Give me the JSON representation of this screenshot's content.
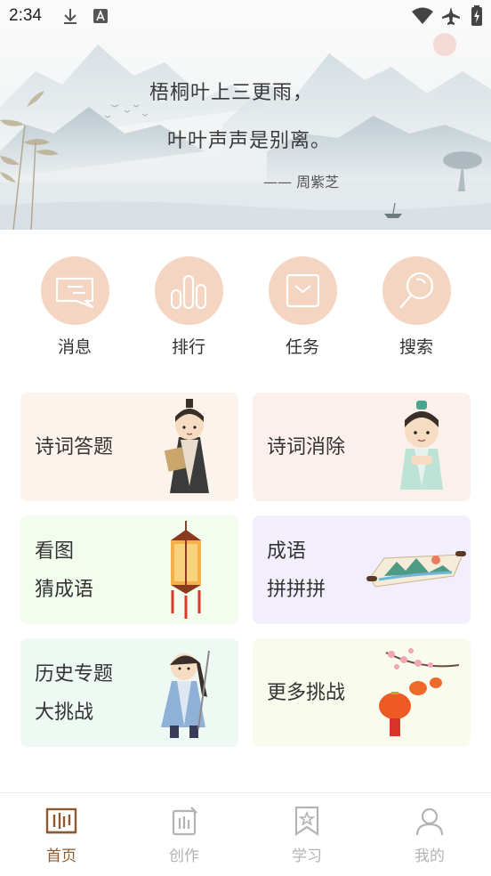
{
  "status_bar": {
    "time": "2:34"
  },
  "hero": {
    "line1": "梧桐叶上三更雨，",
    "line2": "叶叶声声是别离。",
    "author": "—— 周紫芝"
  },
  "quick_actions": [
    {
      "label": "消息",
      "icon": "message-icon"
    },
    {
      "label": "排行",
      "icon": "ranking-icon"
    },
    {
      "label": "任务",
      "icon": "task-icon"
    },
    {
      "label": "搜索",
      "icon": "search-icon"
    }
  ],
  "cards": {
    "poem_quiz": {
      "lines": [
        "诗词答题"
      ]
    },
    "poem_eliminate": {
      "lines": [
        "诗词消除"
      ]
    },
    "guess_idiom": {
      "lines": [
        "看图",
        "猜成语"
      ]
    },
    "idiom_puzzle": {
      "lines": [
        "成语",
        "拼拼拼"
      ]
    },
    "history_challenge": {
      "lines": [
        "历史专题",
        "大挑战"
      ]
    },
    "more_challenges": {
      "lines": [
        "更多挑战"
      ]
    }
  },
  "nav": [
    {
      "label": "首页",
      "active": true
    },
    {
      "label": "创作",
      "active": false
    },
    {
      "label": "学习",
      "active": false
    },
    {
      "label": "我的",
      "active": false
    }
  ],
  "colors": {
    "accent_brown": "#8b5a33",
    "icon_circle": "#f3d5c1",
    "nav_inactive": "#b3b3b3"
  }
}
